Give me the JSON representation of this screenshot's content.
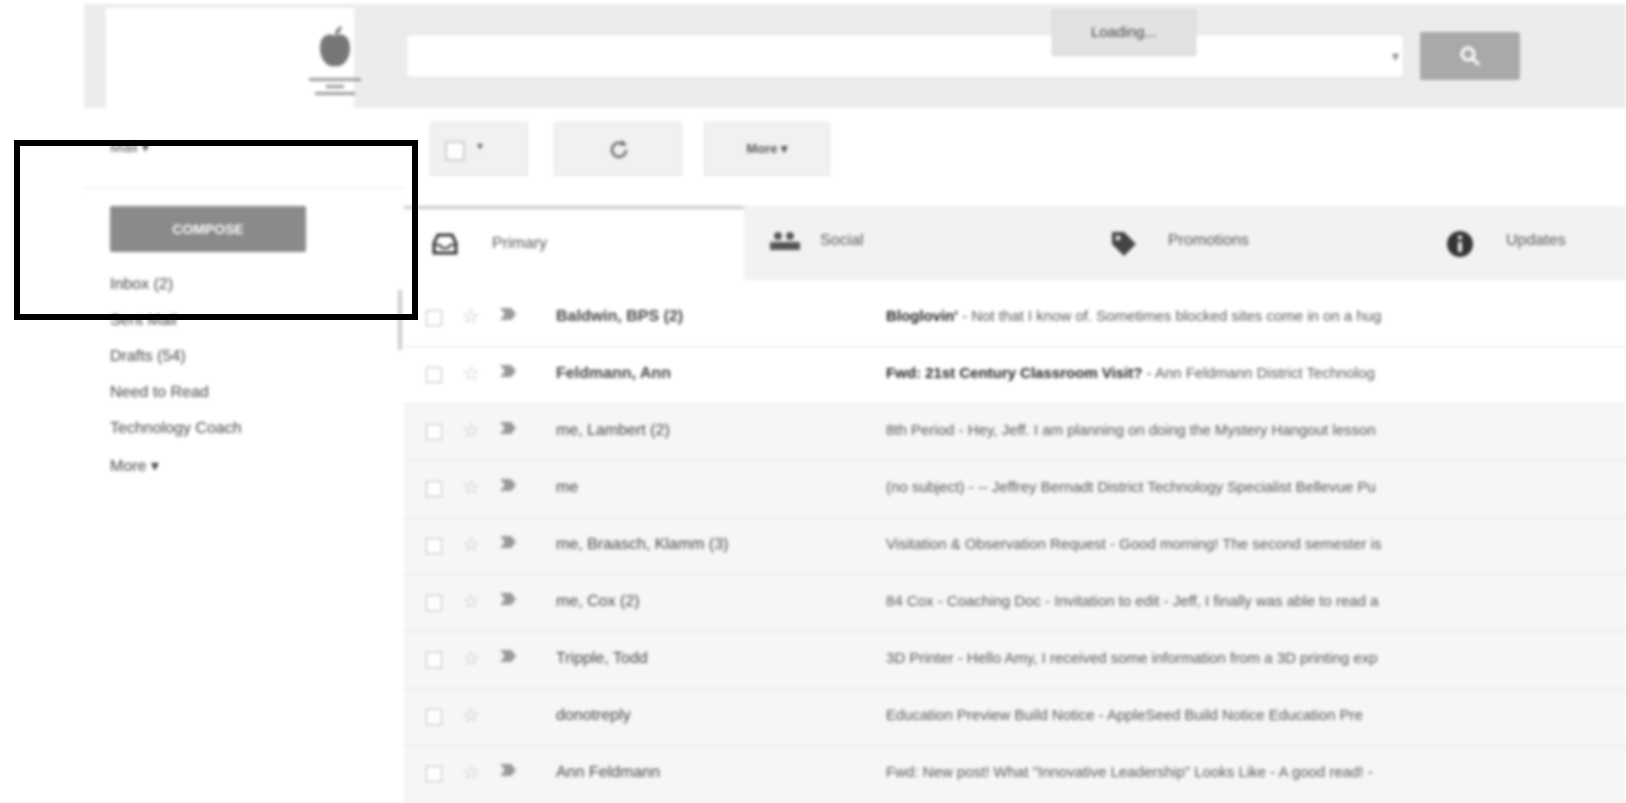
{
  "header": {
    "loading_text": "Loading...",
    "search_placeholder": ""
  },
  "sidebar": {
    "mail_label": "Mail ▾",
    "compose_label": "COMPOSE",
    "items": [
      {
        "label": "Inbox (2)"
      },
      {
        "label": "Sent Mail"
      },
      {
        "label": "Drafts (54)"
      },
      {
        "label": "Need to Read"
      },
      {
        "label": "Technology Coach"
      },
      {
        "label": "More ▾"
      }
    ]
  },
  "toolbar": {
    "more_label": "More ▾"
  },
  "tabs": [
    {
      "label": "Primary"
    },
    {
      "label": "Social"
    },
    {
      "label": "Promotions"
    },
    {
      "label": "Updates"
    }
  ],
  "emails": [
    {
      "sender": "Baldwin, BPS (2)",
      "subject": "Bloglovin'",
      "snippet": " - Not that I know of. Sometimes blocked sites come in on a hug",
      "unread": true,
      "important": true
    },
    {
      "sender": "Feldmann, Ann",
      "subject": "Fwd: 21st Century Classroom Visit?",
      "snippet": " - Ann Feldmann District Technolog",
      "unread": true,
      "important": true
    },
    {
      "sender": "me, Lambert (2)",
      "subject": "8th Period",
      "snippet": " - Hey, Jeff. I am planning on doing the Mystery Hangout lesson",
      "unread": false,
      "important": true
    },
    {
      "sender": "me",
      "subject": "(no subject)",
      "snippet": " - -- Jeffrey Bernadt District Technology Specialist Bellevue Pu",
      "unread": false,
      "important": true
    },
    {
      "sender": "me, Braasch, Klamm (3)",
      "subject": "Visitation & Observation Request",
      "snippet": " - Good morning! The second semester is",
      "unread": false,
      "important": true
    },
    {
      "sender": "me, Cox (2)",
      "subject": "84 Cox - Coaching Doc",
      "snippet": " - Invitation to edit - Jeff, I finally was able to read a",
      "unread": false,
      "important": true
    },
    {
      "sender": "Tripple, Todd",
      "subject": "3D Printer",
      "snippet": " - Hello Amy, I received some information from a 3D printing exp",
      "unread": false,
      "important": true
    },
    {
      "sender": "donotreply",
      "subject": "Education Preview Build Notice",
      "snippet": " - AppleSeed Build Notice Education Pre",
      "unread": false,
      "important": false
    },
    {
      "sender": "Ann Feldmann",
      "subject": "Fwd: New post! What \"Innovative Leadership\" Looks Like",
      "snippet": " - A good read! -",
      "unread": false,
      "important": true
    }
  ]
}
